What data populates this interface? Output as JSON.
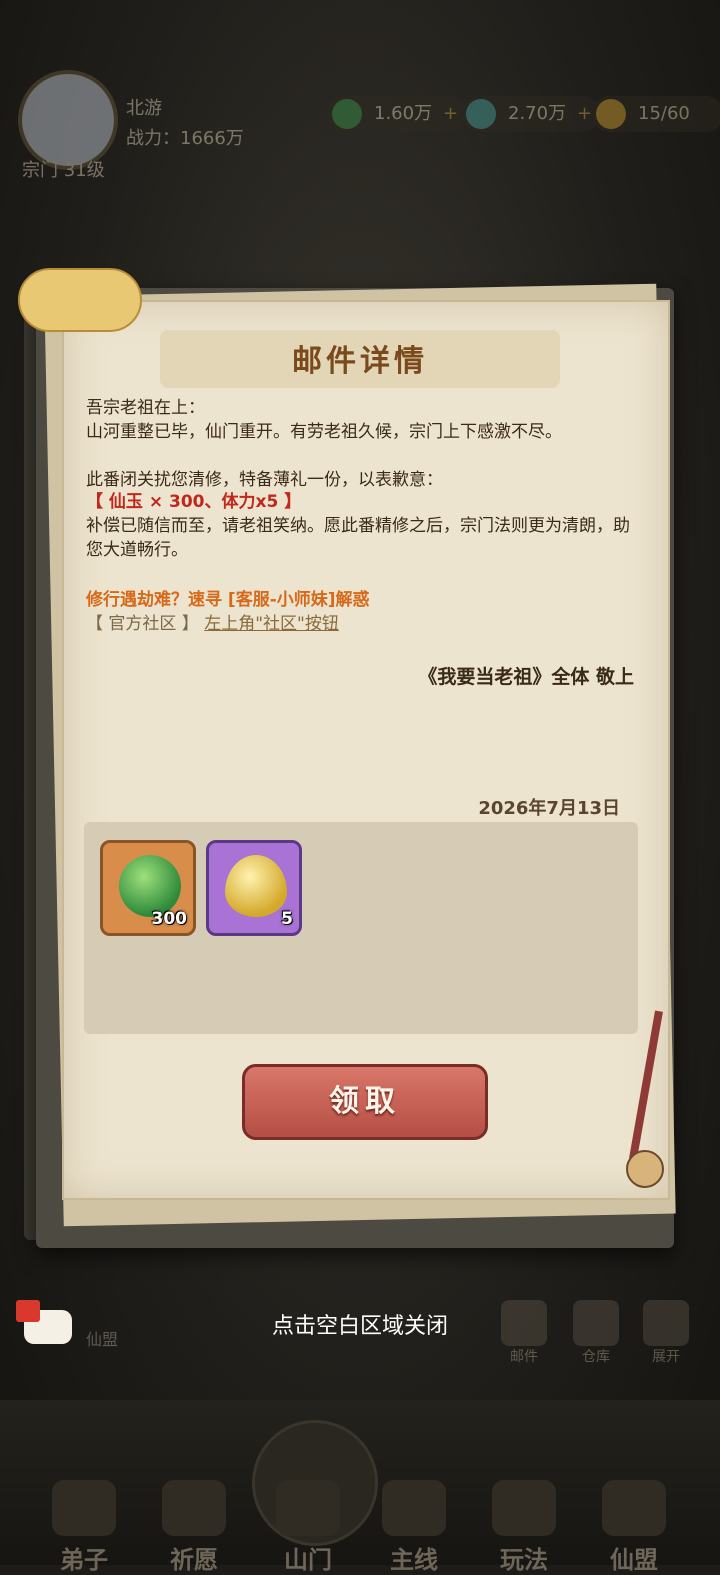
{
  "header": {
    "player_name": "北游",
    "power": "战力：1666万",
    "sect_level": "宗门 31级",
    "resources": [
      {
        "icon": "jade-currency-icon",
        "value": "1.60万",
        "color": "#3a9a4a"
      },
      {
        "icon": "spirit-stone-icon",
        "value": "2.70万",
        "color": "#4aa8a0"
      },
      {
        "icon": "stamina-gourd-icon",
        "value": "15/60",
        "color": "#d9a630"
      }
    ]
  },
  "mail": {
    "title": "邮件详情",
    "greeting": "吾宗老祖在上：",
    "paragraph1": "山河重整已毕，仙门重开。有劳老祖久候，宗门上下感激不尽。",
    "paragraph2": "此番闭关扰您清修，特备薄礼一份，以表歉意：",
    "gift_line": "【 仙玉 × 300、体力x5 】",
    "paragraph3": "补偿已随信而至，请老祖笑纳。愿此番精修之后，宗门法则更为清朗，助您大道畅行。",
    "help_line": "修行遇劫难？速寻 [客服-小师妹]解惑",
    "community_label": "【 官方社区 】",
    "community_link": "左上角\"社区\"按钮",
    "signature": "《我要当老祖》全体 敬上",
    "date": "2026年7月13日",
    "rewards": [
      {
        "name": "jade-reward-item",
        "count": "300"
      },
      {
        "name": "stamina-reward-item",
        "count": "5"
      }
    ],
    "claim_label": "领取"
  },
  "overlay": {
    "close_hint": "点击空白区域关闭",
    "chat_channel": "仙盟"
  },
  "side_buttons": [
    {
      "label": "邮件"
    },
    {
      "label": "仓库"
    },
    {
      "label": "展开"
    }
  ],
  "bottom_nav": [
    {
      "label": "弟子"
    },
    {
      "label": "祈愿"
    },
    {
      "label": "山门"
    },
    {
      "label": "主线"
    },
    {
      "label": "玩法"
    },
    {
      "label": "仙盟"
    }
  ]
}
